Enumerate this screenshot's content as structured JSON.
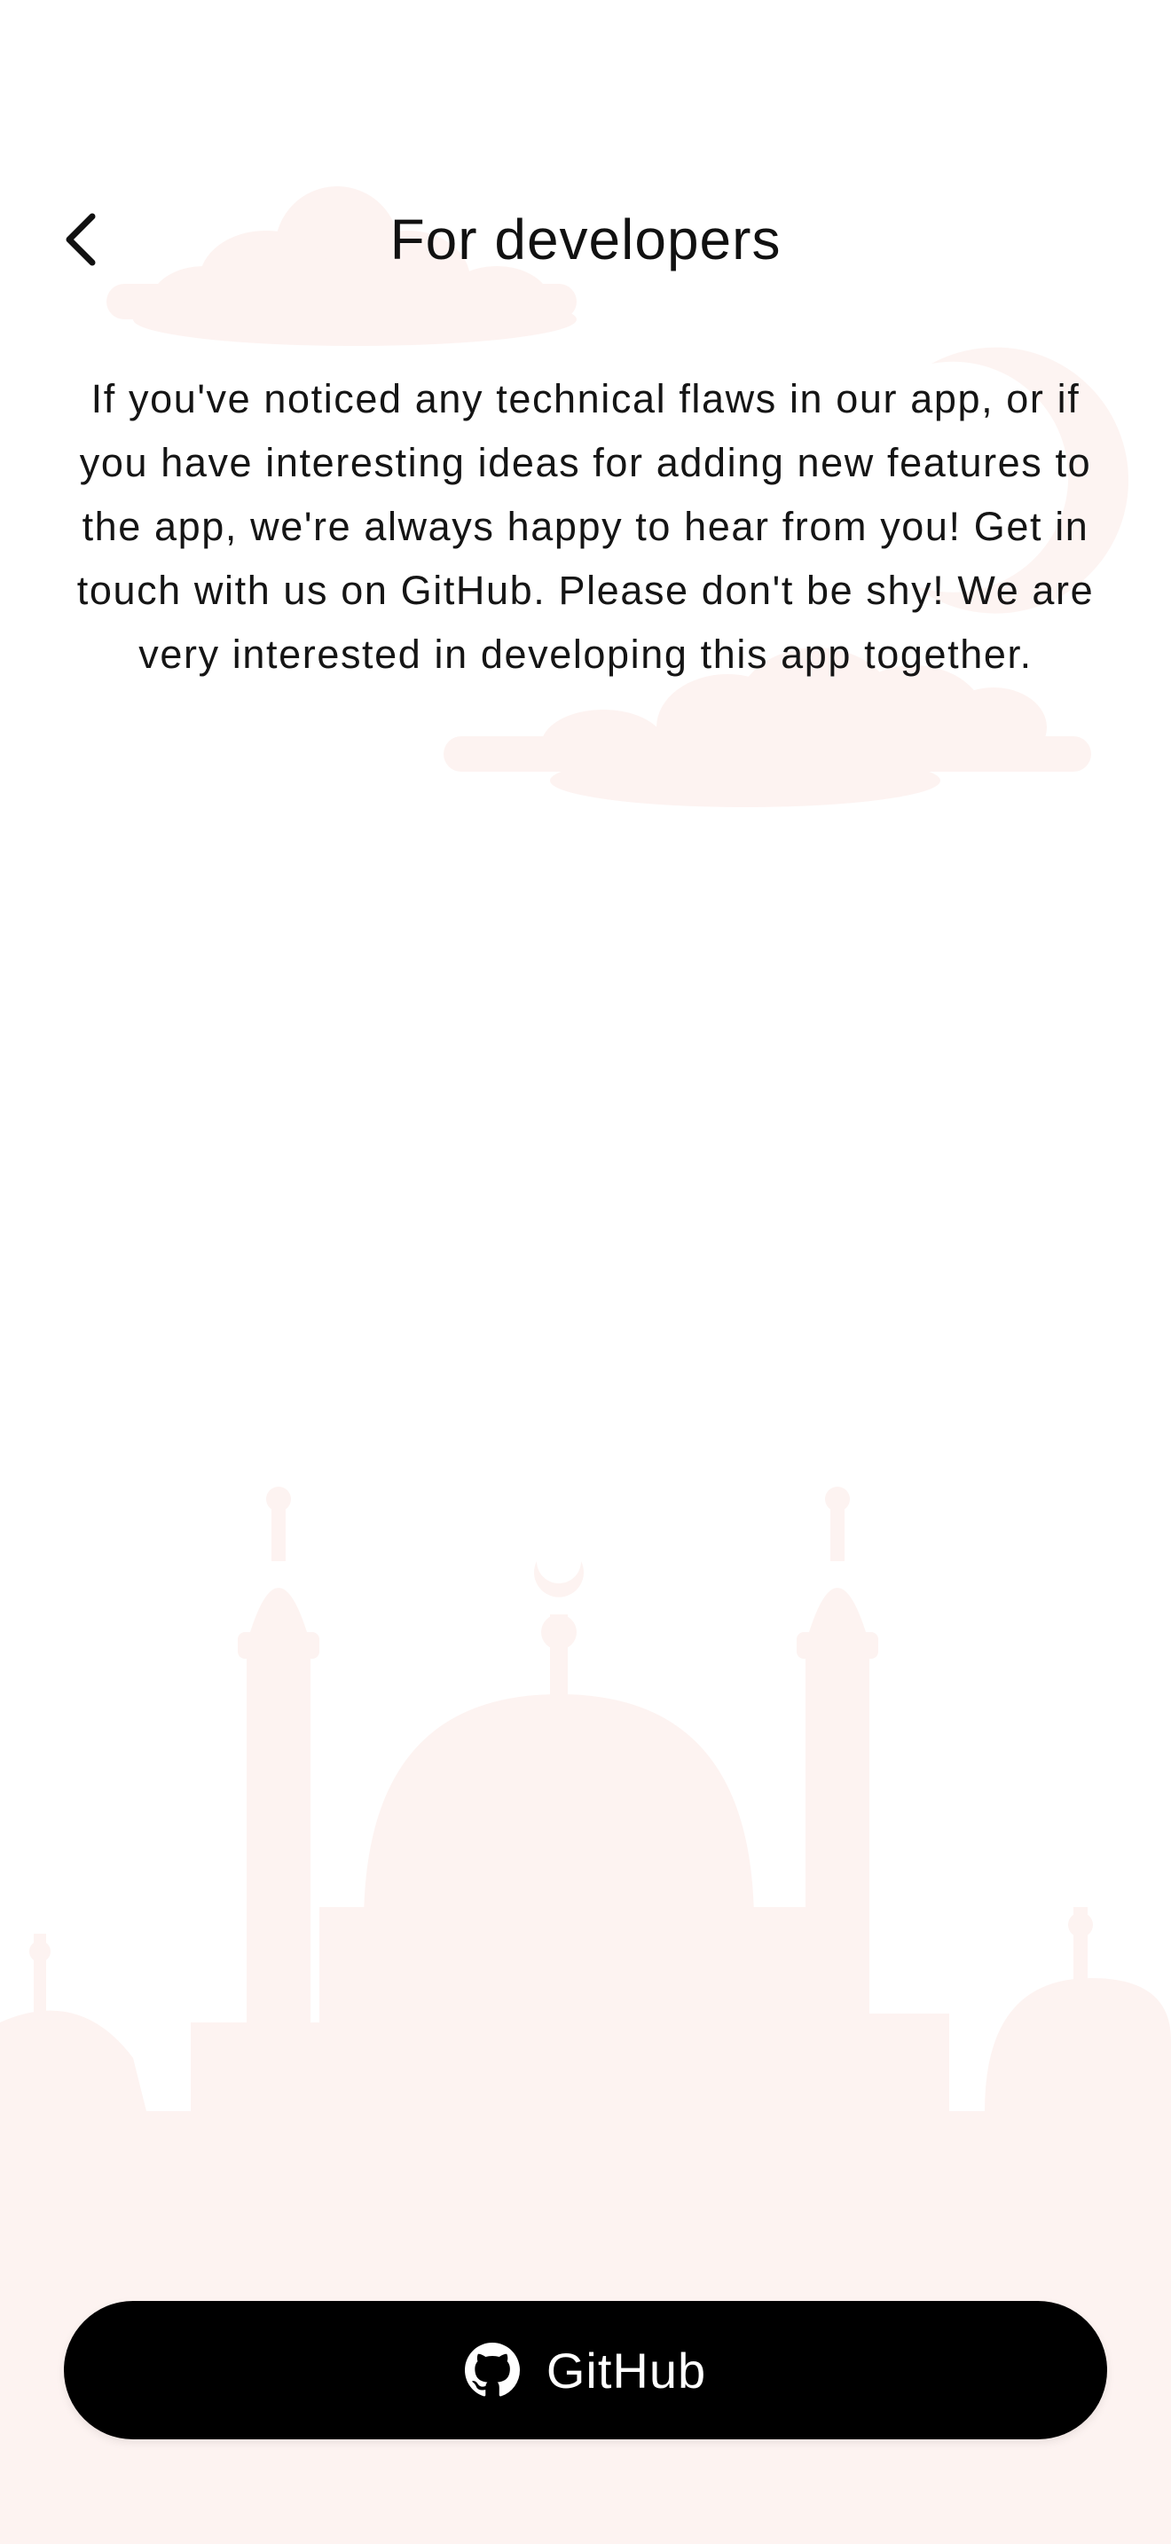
{
  "header": {
    "title": "For developers",
    "back_icon": "chevron-left-icon"
  },
  "content": {
    "description": "If you've noticed any technical flaws in our app, or if you have interesting ideas for adding new features to the app, we're always happy to hear from you! Get in touch with us on GitHub. Please don't be shy! We are very interested in developing this app together."
  },
  "github_button": {
    "label": "GitHub",
    "icon": "github-icon"
  },
  "colors": {
    "background": "#ffffff",
    "decoration": "#fdf3f1",
    "button": "#000000",
    "button_text": "#ffffff",
    "text": "#111111"
  }
}
